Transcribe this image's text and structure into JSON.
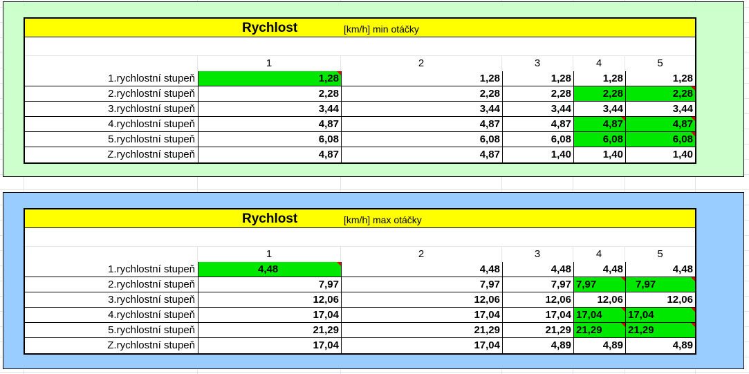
{
  "tables": [
    {
      "title": "Rychlost",
      "subtitle": "[km/h] min otáčky",
      "columns": [
        "1",
        "2",
        "3",
        "4",
        "5"
      ],
      "rows": [
        {
          "label": "1.rychlostní stupeň",
          "values": [
            "1,28",
            "1,28",
            "1,28",
            "1,28",
            "1,28"
          ]
        },
        {
          "label": "2.rychlostní stupeň",
          "values": [
            "2,28",
            "2,28",
            "2,28",
            "2,28",
            "2,28"
          ]
        },
        {
          "label": "3.rychlostní stupeň",
          "values": [
            "3,44",
            "3,44",
            "3,44",
            "3,44",
            "3,44"
          ]
        },
        {
          "label": "4.rychlostní stupeň",
          "values": [
            "4,87",
            "4,87",
            "4,87",
            "4,87",
            "4,87"
          ]
        },
        {
          "label": "5.rychlostní stupeň",
          "values": [
            "6,08",
            "6,08",
            "6,08",
            "6,08",
            "6,08"
          ]
        },
        {
          "label": "Z.rychlostní stupeň",
          "values": [
            "4,87",
            "4,87",
            "1,40",
            "1,40",
            "1,40"
          ]
        }
      ]
    },
    {
      "title": "Rychlost",
      "subtitle": "[km/h] max otáčky",
      "columns": [
        "1",
        "2",
        "3",
        "4",
        "5"
      ],
      "rows": [
        {
          "label": "1.rychlostní stupeň",
          "values": [
            "4,48",
            "4,48",
            "4,48",
            "4,48",
            "4,48"
          ]
        },
        {
          "label": "2.rychlostní stupeň",
          "values": [
            "7,97",
            "7,97",
            "7,97",
            "7,97",
            "7,97"
          ]
        },
        {
          "label": "3.rychlostní stupeň",
          "values": [
            "12,06",
            "12,06",
            "12,06",
            "12,06",
            "12,06"
          ]
        },
        {
          "label": "4.rychlostní stupeň",
          "values": [
            "17,04",
            "17,04",
            "17,04",
            "17,04",
            "17,04"
          ]
        },
        {
          "label": "5.rychlostní stupeň",
          "values": [
            "21,29",
            "21,29",
            "21,29",
            "21,29",
            "21,29"
          ]
        },
        {
          "label": "Z.rychlostní stupeň",
          "values": [
            "17,04",
            "17,04",
            "4,89",
            "4,89",
            "4,89"
          ]
        }
      ]
    }
  ],
  "colors": {
    "panel_min_bg": "#ccffcc",
    "panel_max_bg": "#99ccff",
    "title_bar": "#ffff00",
    "highlight": "#00e800",
    "comment_marker": "#e00000"
  }
}
